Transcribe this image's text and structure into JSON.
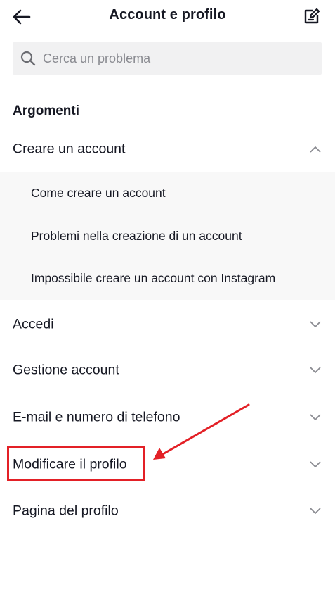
{
  "header": {
    "title": "Account e profilo",
    "back_icon": "back-arrow-icon",
    "edit_icon": "feedback-edit-icon"
  },
  "search": {
    "placeholder": "Cerca un problema",
    "value": "",
    "icon": "search-icon"
  },
  "topics": {
    "heading": "Argomenti",
    "expanded": {
      "label": "Creare un account",
      "state": "expanded",
      "sub_items": [
        "Come creare un account",
        "Problemi nella creazione di un account",
        "Impossibile creare un account con Instagram"
      ]
    },
    "items": [
      {
        "label": "Accedi",
        "state": "collapsed"
      },
      {
        "label": "Gestione account",
        "state": "collapsed"
      },
      {
        "label": "E-mail e numero di telefono",
        "state": "collapsed"
      },
      {
        "label": "Modificare il profilo",
        "state": "collapsed",
        "highlighted": true
      },
      {
        "label": "Pagina del profilo",
        "state": "collapsed"
      }
    ]
  },
  "colors": {
    "annotation": "#e32026",
    "sub_panel_bg": "#f8f8f8",
    "search_bg": "#f1f1f2",
    "text": "#161823",
    "placeholder": "#8a8b91"
  }
}
